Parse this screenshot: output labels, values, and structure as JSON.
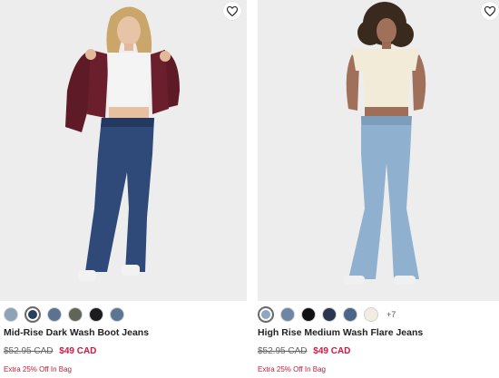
{
  "products": [
    {
      "name": "Mid-Rise Dark Wash Boot Jeans",
      "was_price": "$52.95 CAD",
      "sale_price": "$49 CAD",
      "promo": "Extra 25% Off In Bag",
      "image_icon": "model-dark-wash-boot-jeans",
      "swatches": [
        "#8ea3b8",
        "#2c3e5e",
        "#5b7391",
        "#5f6657",
        "#1c1c1e",
        "#5d7595"
      ],
      "selected_swatch": 1,
      "more_colors": ""
    },
    {
      "name": "High Rise Medium Wash Flare Jeans",
      "was_price": "$52.95 CAD",
      "sale_price": "$49 CAD",
      "promo": "Extra 25% Off In Bag",
      "image_icon": "model-medium-wash-flare-jeans",
      "swatches": [
        "#8fa6bf",
        "#6e86a6",
        "#111114",
        "#2a3550",
        "#4c6488",
        "#f1ede0"
      ],
      "selected_swatch": 0,
      "more_colors": "+7"
    }
  ],
  "colors": {
    "sale": "#d0173e",
    "promo": "#c01e3a",
    "photo_bg": "#ededed"
  }
}
